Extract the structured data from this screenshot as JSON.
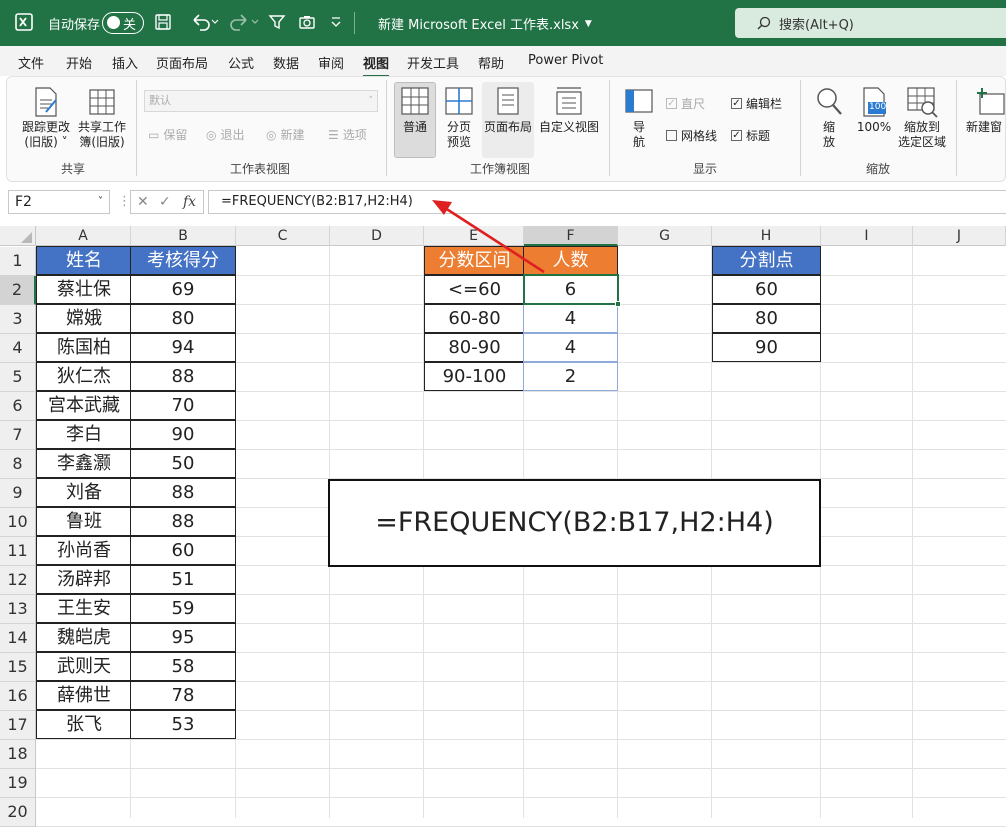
{
  "title_bar": {
    "autosave_label": "自动保存",
    "autosave_state": "关",
    "filename": "新建 Microsoft Excel 工作表.xlsx",
    "search_placeholder": "搜索(Alt+Q)",
    "bg_color": "#217346"
  },
  "menu": [
    "文件",
    "开始",
    "插入",
    "页面布局",
    "公式",
    "数据",
    "审阅",
    "视图",
    "开发工具",
    "帮助",
    "Power Pivot"
  ],
  "menu_active": "视图",
  "ribbon": {
    "share": {
      "btn1_line1": "跟踪更改",
      "btn1_line2": "(旧版) ˅",
      "btn2_line1": "共享工作",
      "btn2_line2": "簿(旧版)",
      "label": "共享"
    },
    "sheet_view": {
      "dropdown": "默认",
      "keep": "保留",
      "exit": "退出",
      "new": "新建",
      "options": "选项",
      "label": "工作表视图"
    },
    "workbook_view": {
      "normal": "普通",
      "page_break_1": "分页",
      "page_break_2": "预览",
      "page_layout": "页面布局",
      "custom": "自定义视图",
      "label": "工作簿视图"
    },
    "show": {
      "nav_1": "导",
      "nav_2": "航",
      "ruler": "直尺",
      "formula_bar": "编辑栏",
      "gridlines": "网格线",
      "headings": "标题",
      "label": "显示"
    },
    "zoom": {
      "zoom_1": "缩",
      "zoom_2": "放",
      "hundred": "100%",
      "hundred_icon": "100",
      "to_sel_1": "缩放到",
      "to_sel_2": "选定区域",
      "label": "缩放"
    },
    "window": {
      "new_window": "新建窗"
    }
  },
  "formula_bar": {
    "name_box": "F2",
    "fx": "fx",
    "formula": "=FREQUENCY(B2:B17,H2:H4)"
  },
  "columns": [
    "A",
    "B",
    "C",
    "D",
    "E",
    "F",
    "G",
    "H",
    "I",
    "J"
  ],
  "rows": [
    "1",
    "2",
    "3",
    "4",
    "5",
    "6",
    "7",
    "8",
    "9",
    "10",
    "11",
    "12",
    "13",
    "14",
    "15",
    "16",
    "17",
    "18",
    "19",
    "20"
  ],
  "table_scores": {
    "headers": [
      "姓名",
      "考核得分"
    ],
    "rows": [
      [
        "蔡壮保",
        "69"
      ],
      [
        "嫦娥",
        "80"
      ],
      [
        "陈国柏",
        "94"
      ],
      [
        "狄仁杰",
        "88"
      ],
      [
        "宫本武藏",
        "70"
      ],
      [
        "李白",
        "90"
      ],
      [
        "李鑫灏",
        "50"
      ],
      [
        "刘备",
        "88"
      ],
      [
        "鲁班",
        "88"
      ],
      [
        "孙尚香",
        "60"
      ],
      [
        "汤辟邦",
        "51"
      ],
      [
        "王生安",
        "59"
      ],
      [
        "魏皑虎",
        "95"
      ],
      [
        "武则天",
        "58"
      ],
      [
        "薛佛世",
        "78"
      ],
      [
        "张飞",
        "53"
      ]
    ]
  },
  "table_freq": {
    "headers": [
      "分数区间",
      "人数"
    ],
    "rows": [
      [
        "<=60",
        "6"
      ],
      [
        "60-80",
        "4"
      ],
      [
        "80-90",
        "4"
      ],
      [
        "90-100",
        "2"
      ]
    ]
  },
  "table_bins": {
    "header": "分割点",
    "rows": [
      "60",
      "80",
      "90"
    ]
  },
  "callout_formula": "=FREQUENCY(B2:B17,H2:H4)",
  "colors": {
    "header_blue": "#4472c4",
    "header_orange": "#ed7d31",
    "arrow_red": "#e02020",
    "excel_green": "#217346"
  }
}
